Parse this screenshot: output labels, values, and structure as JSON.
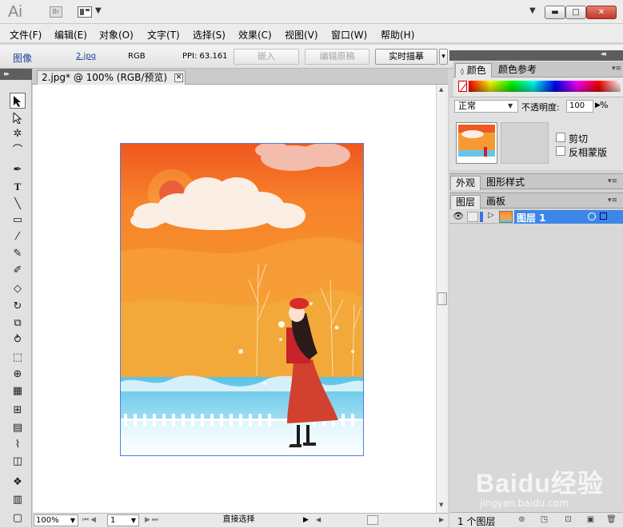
{
  "app": {
    "logo": "Ai",
    "bridge_label": "Br",
    "caret": "▼"
  },
  "window_controls": {
    "minimize": "▬",
    "maximize": "□",
    "close": "✕"
  },
  "menu": [
    "文件(F)",
    "编辑(E)",
    "对象(O)",
    "文字(T)",
    "选择(S)",
    "效果(C)",
    "视图(V)",
    "窗口(W)",
    "帮助(H)"
  ],
  "control_bar": {
    "object_type": "图像",
    "file_link": "2.jpg",
    "color_mode": "RGB",
    "ppi": "PPI: 63.161",
    "embed_button": "嵌入",
    "edit_original_button": "编辑原稿",
    "live_trace_button": "实时描摹",
    "trace_caret": "▾"
  },
  "document": {
    "tab_title": "2.jpg* @ 100% (RGB/预览)",
    "tab_close": "✕",
    "zoom": "100%",
    "page": "1",
    "status_label": "直接选择"
  },
  "color_panel": {
    "tabs": [
      "颜色",
      "颜色参考"
    ],
    "active_tab": "颜色"
  },
  "transparency_panel": {
    "blend_mode": "正常",
    "opacity_label": "不透明度:",
    "opacity_value": "100",
    "opacity_unit": "%",
    "clip_label": "剪切",
    "invert_mask_label": "反相蒙版"
  },
  "appearance_tabs": [
    "外观",
    "图形样式"
  ],
  "layers_tabs": [
    "图层",
    "画板"
  ],
  "layers": [
    {
      "name": "图层 1",
      "color": "#3c86e8"
    }
  ],
  "layers_footer": {
    "count_label": "1 个图层"
  },
  "watermark": {
    "text": "Baidu经验",
    "url": "jingyan.baidu.com"
  },
  "colors": {
    "selection_blue": "#3c86e8",
    "artwork_border": "#4f7ed8"
  }
}
